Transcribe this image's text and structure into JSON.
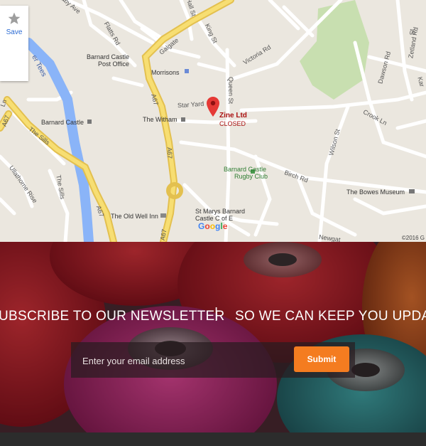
{
  "map": {
    "save_label": "Save",
    "business_name": "Zine Ltd",
    "business_status": "CLOSED",
    "copyright": "©2016 G",
    "google_logo": [
      "G",
      "o",
      "o",
      "g",
      "l",
      "e"
    ],
    "google_colors": [
      "#4285f4",
      "#ea4335",
      "#fbbc05",
      "#4285f4",
      "#34a853",
      "#ea4335"
    ],
    "places": {
      "barnard_castle_post_office": [
        "Barnard Castle",
        "Post Office"
      ],
      "morrisons": "Morrisons",
      "barnard_castle": "Barnard Castle",
      "the_witham": "The Witham",
      "rugby_club": [
        "Barnard Castle",
        "Rugby Club"
      ],
      "the_old_well_inn": "The Old Well Inn",
      "st_marys": [
        "St Marys Barnard",
        "Castle C of E"
      ],
      "the_bowes_museum": "The Bowes Museum"
    },
    "roads": {
      "galgate": "Galgate",
      "flatts_rd": "Flatts Rd",
      "king_st": "King St",
      "hall_st": "Hall St",
      "bay_ave": "aby Ave",
      "victoria_rd": "Victoria Rd",
      "queen_st": "Queen St",
      "star_yard": "Star Yard",
      "a67_north": "A67",
      "a67_mid": "A67",
      "a67_south": "A67",
      "a67_bottom": "A67",
      "a67_left": "A67",
      "the_sills_1": "The Sills",
      "the_sills_2": "The Sills",
      "river_tees": "er Tees",
      "ullathorne_rise": "Ullathorne Rise",
      "birch_rd": "Birch Rd",
      "wilson_st": "Wilson St",
      "crook_ln": "Crook Ln",
      "dawson_rd": "Dawson Rd",
      "zetland_rd": "Zetland Rd",
      "newgate": "Newgat",
      "st_right": "St",
      "ln_left": "Ln",
      "kar": "Kar"
    }
  },
  "newsletter": {
    "title_left": "UBSCRIBE TO OUR NEWSLETTER",
    "separator": "|",
    "title_right": "SO WE CAN KEEP YOU UPDATE",
    "email_placeholder": "Enter your email address",
    "submit_label": "Submit",
    "colors": {
      "accent": "#f47c20"
    }
  }
}
